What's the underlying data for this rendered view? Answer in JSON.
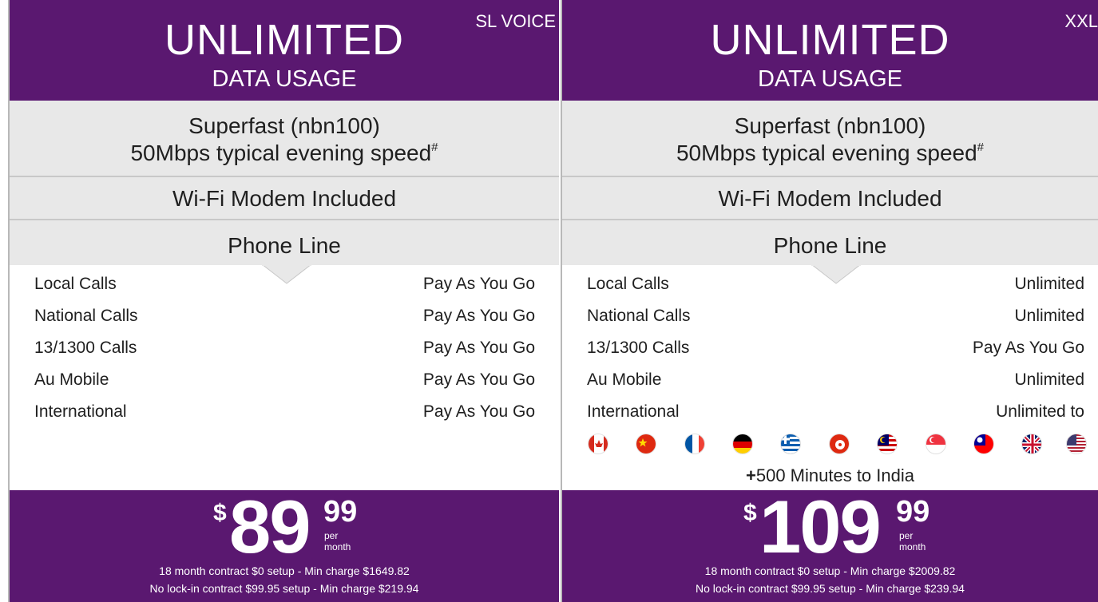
{
  "plans": [
    {
      "headline": "UNLIMITED",
      "subheadline": "DATA USAGE",
      "tag": "SL VOICE",
      "speed_line1": "Superfast (nbn100)",
      "speed_line2": "50Mbps typical evening speed",
      "speed_footnote": "#",
      "modem": "Wi-Fi Modem Included",
      "phone_line": "Phone Line",
      "calls": [
        {
          "name": "Local Calls",
          "value": "Pay As You Go"
        },
        {
          "name": "National Calls",
          "value": "Pay As You Go"
        },
        {
          "name": "13/1300 Calls",
          "value": "Pay As You Go"
        },
        {
          "name": "Au Mobile",
          "value": "Pay As You Go"
        },
        {
          "name": "International",
          "value": "Pay As You Go"
        }
      ],
      "price": {
        "currency": "$",
        "whole": "89",
        "cents": "99",
        "period": "per month"
      },
      "terms": [
        "18 month contract $0 setup - Min charge $1649.82",
        "No lock-in contract $99.95 setup - Min charge $219.94"
      ]
    },
    {
      "headline": "UNLIMITED",
      "subheadline": "DATA USAGE",
      "tag": "XXL",
      "speed_line1": "Superfast (nbn100)",
      "speed_line2": "50Mbps typical evening speed",
      "speed_footnote": "#",
      "modem": "Wi-Fi Modem Included",
      "phone_line": "Phone Line",
      "calls": [
        {
          "name": "Local Calls",
          "value": "Unlimited"
        },
        {
          "name": "National Calls",
          "value": "Unlimited"
        },
        {
          "name": "13/1300 Calls",
          "value": "Pay As You Go"
        },
        {
          "name": "Au Mobile",
          "value": "Unlimited"
        },
        {
          "name": "International",
          "value": "Unlimited to"
        }
      ],
      "flags": [
        "canada-flag-icon",
        "china-flag-icon",
        "france-flag-icon",
        "germany-flag-icon",
        "greece-flag-icon",
        "hong-kong-flag-icon",
        "malaysia-flag-icon",
        "singapore-flag-icon",
        "taiwan-flag-icon",
        "uk-flag-icon",
        "usa-flag-icon"
      ],
      "india_plus": "+",
      "india_text": "500 Minutes to India",
      "price": {
        "currency": "$",
        "whole": "109",
        "cents": "99",
        "period": "per month"
      },
      "terms": [
        "18 month contract $0 setup - Min charge $2009.82",
        "No lock-in contract $99.95 setup - Min charge $239.94"
      ]
    }
  ],
  "colors": {
    "brand_purple": "#5a1870",
    "band_grey": "#e8e8e8"
  }
}
